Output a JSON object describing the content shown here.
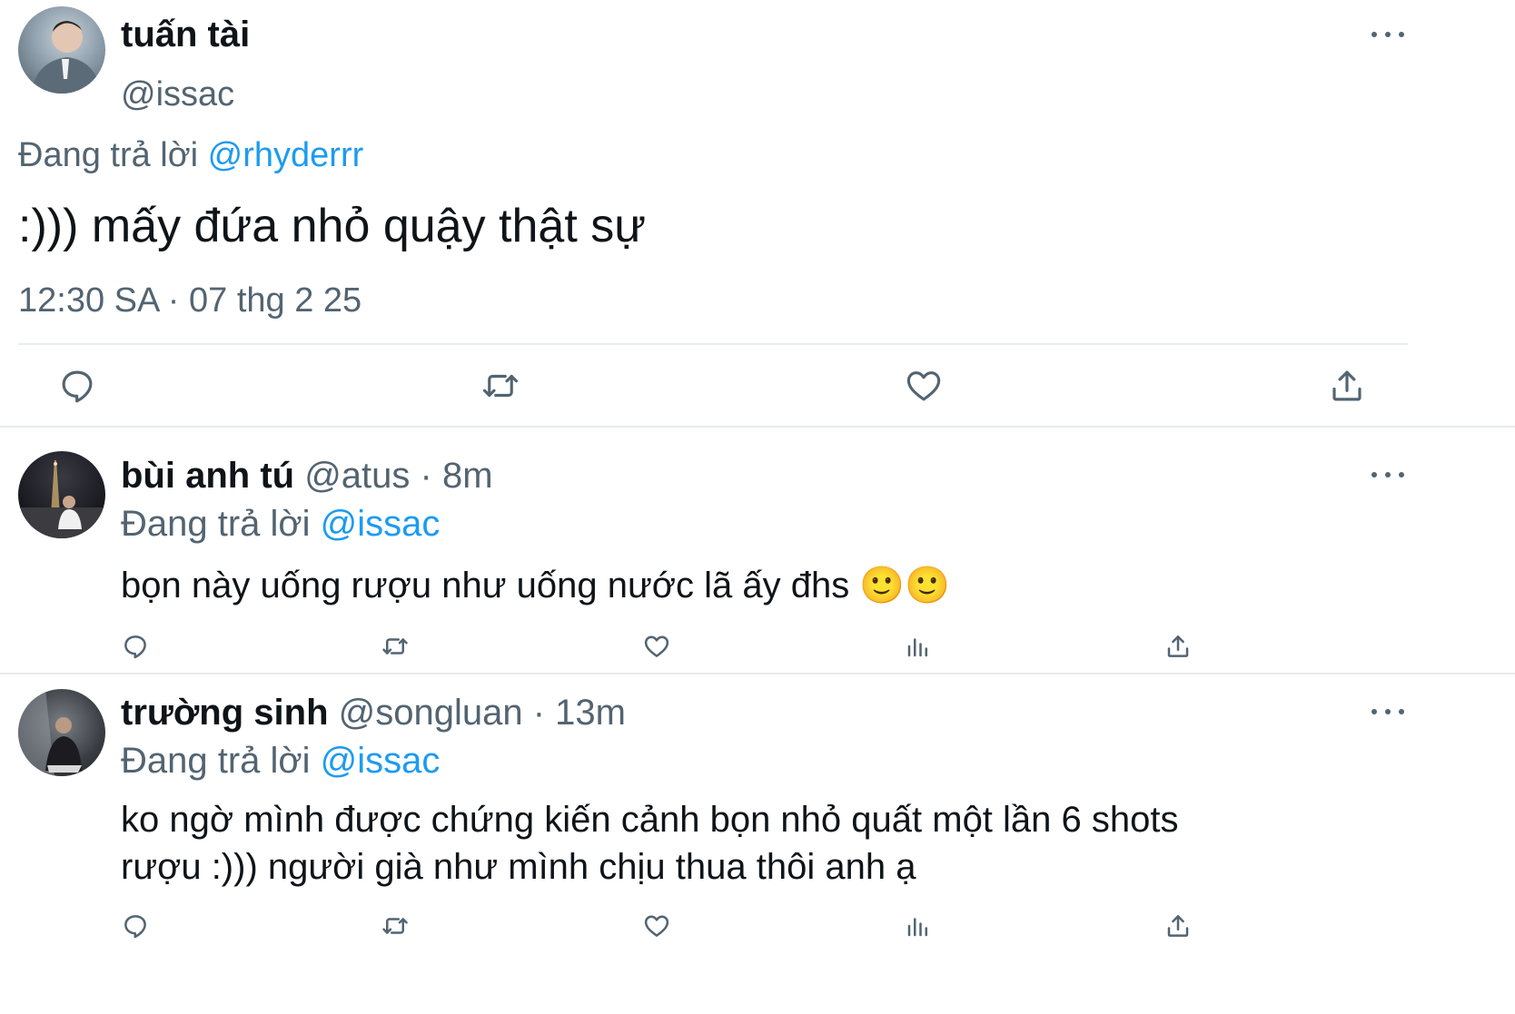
{
  "main_tweet": {
    "display_name": "tuấn tài",
    "handle": "@issac",
    "replying_prefix": "Đang trả lời",
    "replying_to": "@rhyderrr",
    "text": ":))) mấy đứa nhỏ quậy thật sự",
    "timestamp": "12:30 SA · 07 thg 2 25",
    "actions": [
      "reply-icon",
      "retweet-icon",
      "like-icon",
      "share-icon"
    ]
  },
  "replies": [
    {
      "display_name": "bùi anh tú",
      "handle": "@atus",
      "time_sep": "·",
      "time": "8m",
      "replying_prefix": "Đang trả lời",
      "replying_to": "@issac",
      "text": "bọn này uống rượu như uống nước lã ấy đhs",
      "emoji": "🙂🙂",
      "actions": [
        "reply-icon",
        "retweet-icon",
        "like-icon",
        "views-icon",
        "share-icon"
      ]
    },
    {
      "display_name": "trường sinh",
      "handle": "@songluan",
      "time_sep": "·",
      "time": "13m",
      "replying_prefix": "Đang trả lời",
      "replying_to": "@issac",
      "text_line1": "ko ngờ mình được chứng kiến cảnh bọn nhỏ quất một lần 6 shots",
      "text_line2": "rượu :))) người già như mình chịu thua thôi anh ạ",
      "actions": [
        "reply-icon",
        "retweet-icon",
        "like-icon",
        "views-icon",
        "share-icon"
      ]
    }
  ],
  "colors": {
    "text": "#0f1419",
    "muted": "#536471",
    "link": "#1d9bf0",
    "divider": "#e6ecf0"
  }
}
